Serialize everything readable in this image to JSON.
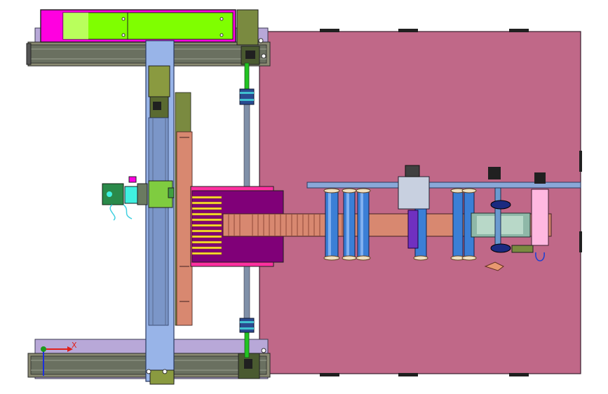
{
  "viewport": {
    "background": "#ffffff"
  },
  "triad": {
    "x_label": "X",
    "x_color": "#e0201c",
    "y_color": "#1c9a1c",
    "z_color": "#1c2ee0"
  },
  "colors": {
    "base_plate": "#c06888",
    "rail_frame": "#7a7a9a",
    "rail_inner": "#b8a8d8",
    "motor_green": "#7fff00",
    "motor_magenta": "#ff00e0",
    "gantry": "#98b4e8",
    "shaft_green": "#22c422",
    "roller_blue": "#3b7fd6",
    "belt_salmon": "#d88870",
    "comb_purple": "#800078",
    "comb_yellow": "#ffe030",
    "pulley_teal": "#8fb8a8",
    "purple_block": "#7030c0"
  }
}
